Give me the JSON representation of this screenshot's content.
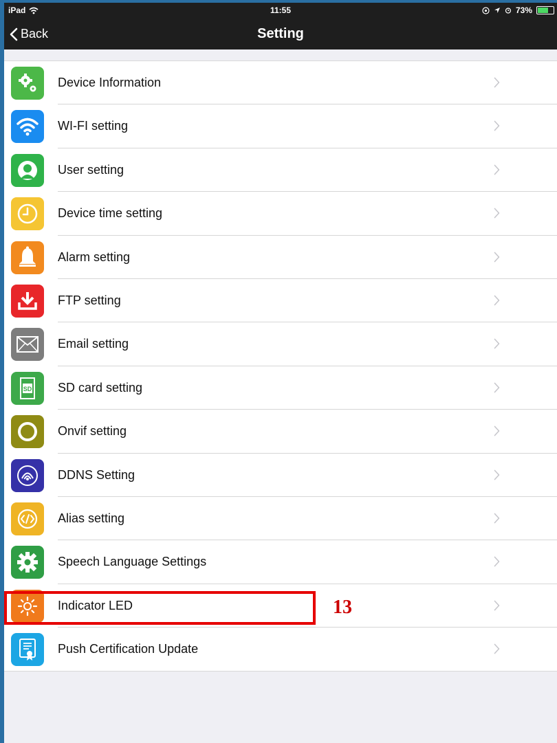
{
  "status_bar": {
    "device": "iPad",
    "time": "11:55",
    "battery": "73%",
    "battery_level": 0.73
  },
  "nav": {
    "back_label": "Back",
    "title": "Setting"
  },
  "items": [
    {
      "label": "Device Information",
      "icon": "gears-icon",
      "color": "#4cb848"
    },
    {
      "label": "WI-FI setting",
      "icon": "wifi-icon",
      "color": "#1a8cf0"
    },
    {
      "label": "User setting",
      "icon": "user-icon",
      "color": "#2fb34a"
    },
    {
      "label": "Device time setting",
      "icon": "clock-icon",
      "color": "#f5c533"
    },
    {
      "label": "Alarm setting",
      "icon": "bell-icon",
      "color": "#f28a1f"
    },
    {
      "label": "FTP setting",
      "icon": "download-icon",
      "color": "#e8262a"
    },
    {
      "label": "Email setting",
      "icon": "envelope-icon",
      "color": "#7d7d7d"
    },
    {
      "label": "SD card setting",
      "icon": "sd-card-icon",
      "color": "#3da94a"
    },
    {
      "label": "Onvif setting",
      "icon": "ring-icon",
      "color": "#8f8b14"
    },
    {
      "label": "DDNS Setting",
      "icon": "ddns-icon",
      "color": "#3531a8"
    },
    {
      "label": "Alias setting",
      "icon": "code-icon",
      "color": "#efb425"
    },
    {
      "label": "Speech Language Settings",
      "icon": "gear-icon",
      "color": "#2f9e45"
    },
    {
      "label": "Indicator LED",
      "icon": "sun-icon",
      "color": "#f07a1c"
    },
    {
      "label": "Push Certification Update",
      "icon": "certificate-icon",
      "color": "#1ca6e4"
    }
  ],
  "annotation": {
    "number": "13",
    "color": "#cc0000"
  }
}
